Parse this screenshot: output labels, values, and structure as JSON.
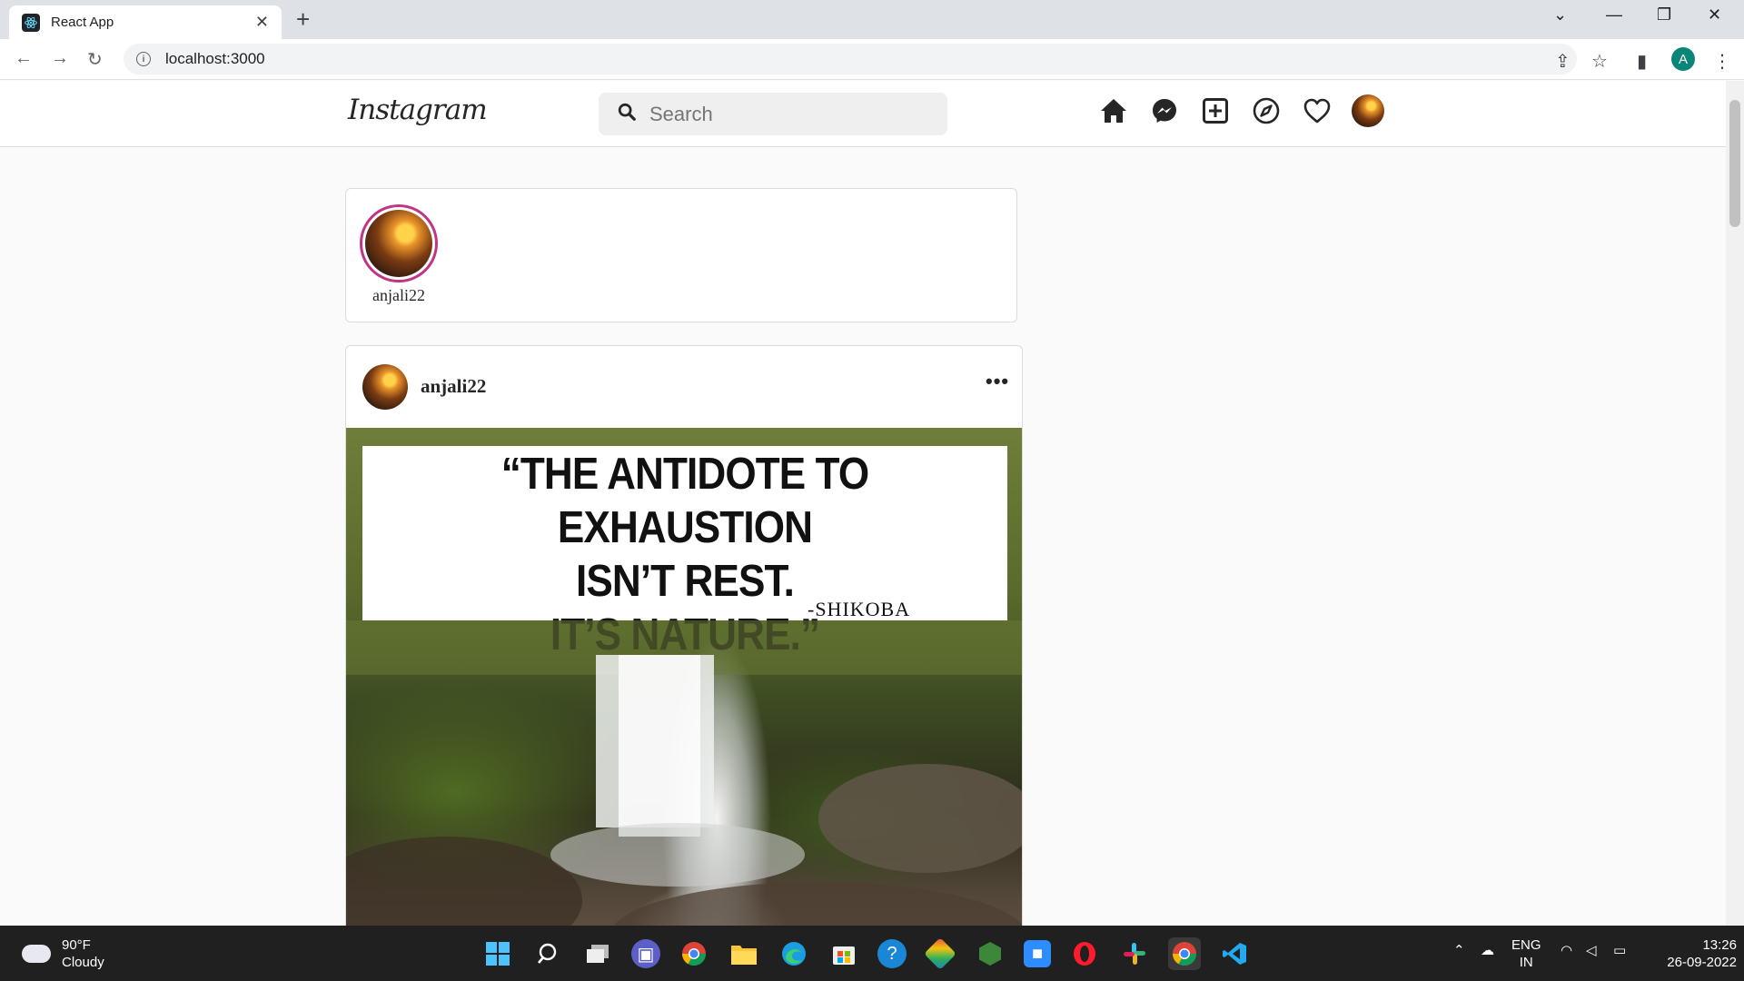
{
  "browser": {
    "tab_title": "React App",
    "new_tab": "+",
    "url": "localhost:3000",
    "profile_initial": "A"
  },
  "app": {
    "logo": "Instagram",
    "search_placeholder": "Search",
    "nav": [
      "home-icon",
      "messenger-icon",
      "new-post-icon",
      "explore-icon",
      "activity-heart-icon",
      "profile-avatar"
    ]
  },
  "stories": [
    {
      "username": "anjali22"
    }
  ],
  "post": {
    "username": "anjali22",
    "more": "•••",
    "image_text": {
      "quote_line1": "“THE ANTIDOTE TO EXHAUSTION",
      "quote_line2": "ISN’T REST.",
      "quote_line3": "IT’S NATURE.”",
      "author": "-SHIKOBA"
    }
  },
  "taskbar": {
    "weather_temp": "90°F",
    "weather_desc": "Cloudy",
    "lang_top": "ENG",
    "lang_bottom": "IN",
    "time": "13:26",
    "date": "26-09-2022"
  },
  "colors": {
    "story_ring": "#c13584",
    "profile_badge": "#0b8577",
    "taskbar": "#202020"
  }
}
